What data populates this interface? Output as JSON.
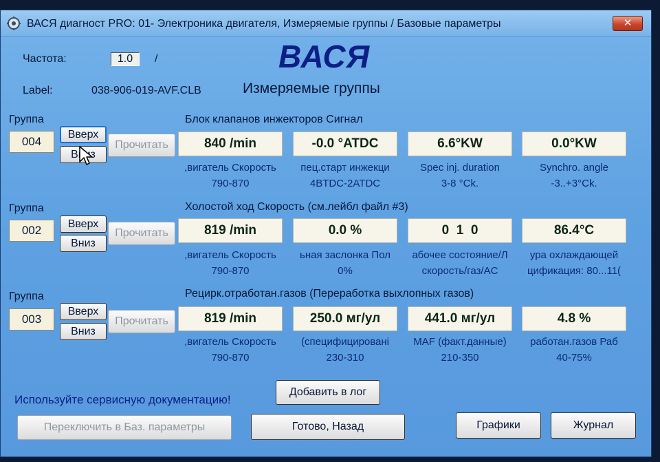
{
  "window": {
    "title": "ВАСЯ диагност PRO: 01- Электроника двигателя,  Измеряемые группы / Базовые параметры",
    "close_label": "✕"
  },
  "header": {
    "freq_label": "Частота:",
    "freq_value": "1.0",
    "freq_sep": "/",
    "label_key": "Label:",
    "label_value": "038-906-019-AVF.CLB",
    "brand": "ВАСЯ",
    "subtitle": "Измеряемые группы"
  },
  "groups": [
    {
      "label": "Группа",
      "number": "004",
      "up": "Вверх",
      "down": "Вниз",
      "read": "Прочитать",
      "title": "Блок клапанов инжекторов Сигнал",
      "values": [
        "840 /min",
        "-0.0 °ATDC",
        "6.6°KW",
        "0.0°KW"
      ],
      "desc1": [
        ",вигатель Скорость",
        "пец.старт инжекци",
        "Spec inj. duration",
        "Synchro. angle"
      ],
      "desc2": [
        "790-870",
        "4BTDC-2ATDC",
        "3-8 °Ck.",
        "-3..+3°Ck."
      ]
    },
    {
      "label": "Группа",
      "number": "002",
      "up": "Вверх",
      "down": "Вниз",
      "read": "Прочитать",
      "title": "Холостой ход Скорость (см.лейбл файл #3)",
      "values": [
        "819 /min",
        "0.0 %",
        "0  1  0",
        "86.4°C"
      ],
      "desc1": [
        ",вигатель Скорость",
        "ьная заслонка Пол",
        "абочее состояние/Л",
        "ура охлаждающей"
      ],
      "desc2": [
        "790-870",
        "0%",
        "скорость/газ/AC",
        "цификация: 80...11("
      ]
    },
    {
      "label": "Группа",
      "number": "003",
      "up": "Вверх",
      "down": "Вниз",
      "read": "Прочитать",
      "title": "Рецирк.отработан.газов (Переработка выхлопных газов)",
      "values": [
        "819 /min",
        "250.0 мг/ул",
        "441.0 мг/ул",
        "4.8 %"
      ],
      "desc1": [
        ",вигатель Скорость",
        "(специфицировані",
        "MAF (факт.данные)",
        "работан.газов Раб"
      ],
      "desc2": [
        "790-870",
        "230-310",
        "210-350",
        "40-75%"
      ]
    }
  ],
  "footer": {
    "service_note": "Используйте сервисную документацию!",
    "add_log": "Добавить в лог",
    "switch_basic": "Переключить в Баз. параметры",
    "done_back": "Готово, Назад",
    "graphs": "Графики",
    "journal": "Журнал"
  },
  "colors": {
    "window_bg": "#5fa2e2",
    "brand": "#0d1f86",
    "value_text": "#0b2617",
    "desc_text": "#0b2a73"
  }
}
